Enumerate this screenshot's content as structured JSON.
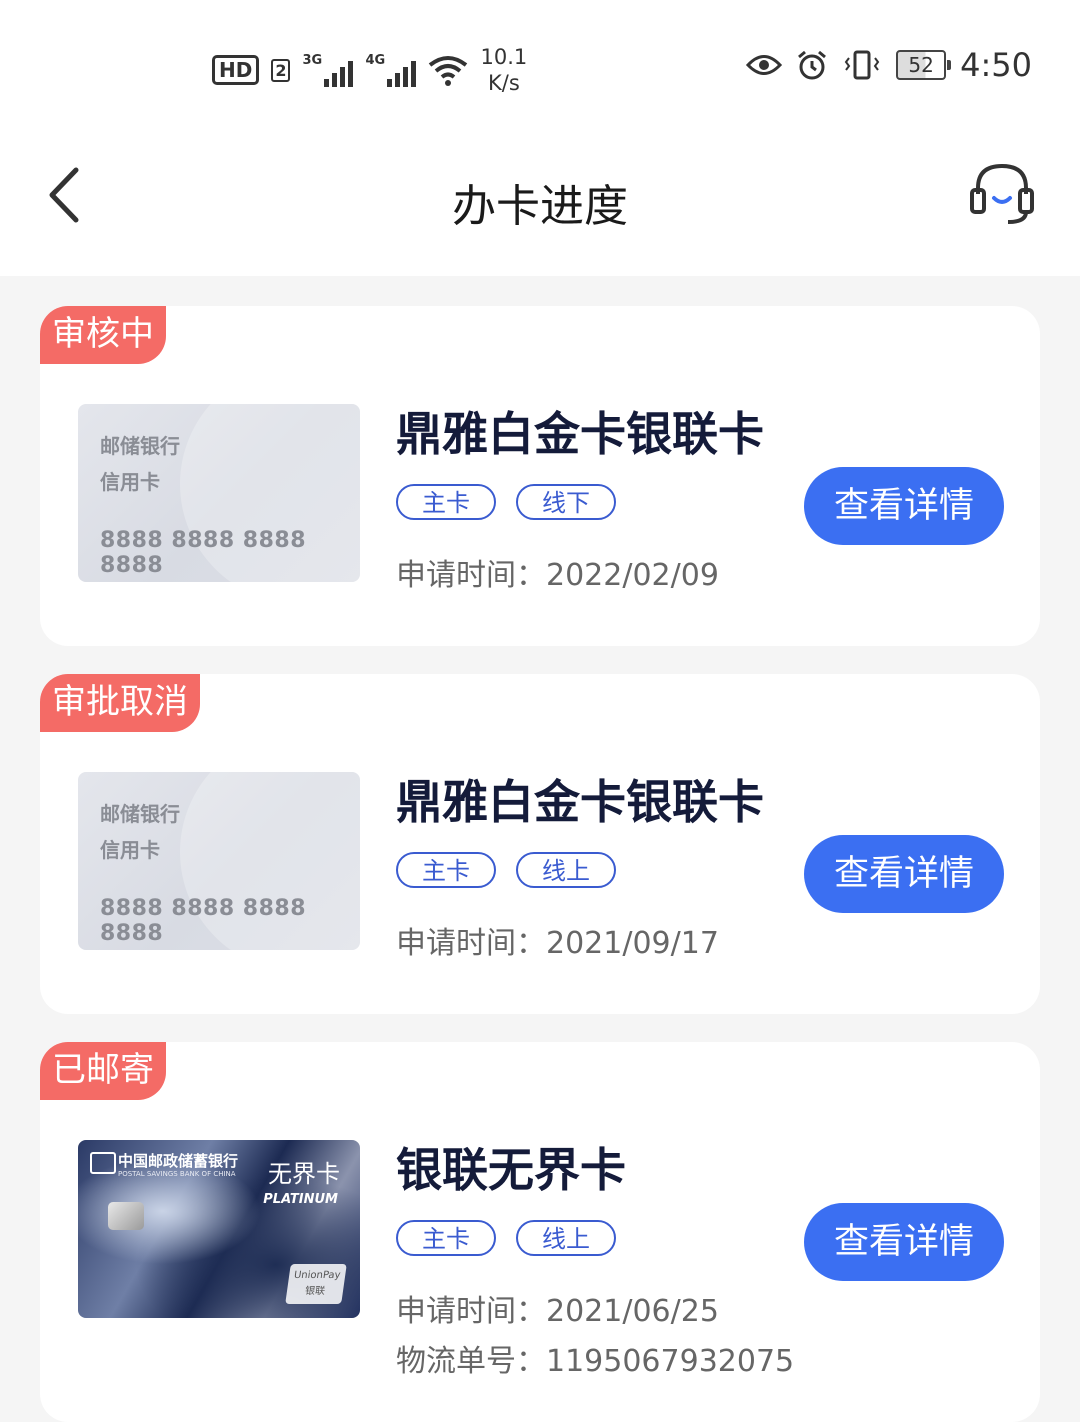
{
  "status_bar": {
    "hd": "HD",
    "sim_num": "2",
    "sig1_label": "3G",
    "sig2_label": "4G",
    "speed_value": "10.1",
    "speed_unit": "K/s",
    "battery": "52",
    "time": "4:50"
  },
  "header": {
    "title": "办卡进度"
  },
  "applications": [
    {
      "status": "审核中",
      "card_bank": "邮储银行",
      "card_type": "信用卡",
      "card_number": "8888 8888 8888 8888",
      "name": "鼎雅白金卡银联卡",
      "tags": [
        "主卡",
        "线下"
      ],
      "apply_time_label": "申请时间：",
      "apply_time": "2022/02/09",
      "button": "查看详情"
    },
    {
      "status": "审批取消",
      "card_bank": "邮储银行",
      "card_type": "信用卡",
      "card_number": "8888 8888 8888 8888",
      "name": "鼎雅白金卡银联卡",
      "tags": [
        "主卡",
        "线上"
      ],
      "apply_time_label": "申请时间：",
      "apply_time": "2021/09/17",
      "button": "查看详情"
    },
    {
      "status": "已邮寄",
      "card_art": {
        "bank": "中国邮政储蓄银行",
        "bank_en": "POSTAL SAVINGS BANK OF CHINA",
        "card_name": "无界卡",
        "platinum": "PLATINUM",
        "network": "UnionPay 银联"
      },
      "name": "银联无界卡",
      "tags": [
        "主卡",
        "线上"
      ],
      "apply_time_label": "申请时间：",
      "apply_time": "2021/06/25",
      "tracking_label": "物流单号：",
      "tracking_number": "1195067932075",
      "button": "查看详情"
    }
  ],
  "colors": {
    "accent": "#3b6ff2",
    "status_tag": "#f46b66",
    "tag_border": "#3a5bd0"
  }
}
